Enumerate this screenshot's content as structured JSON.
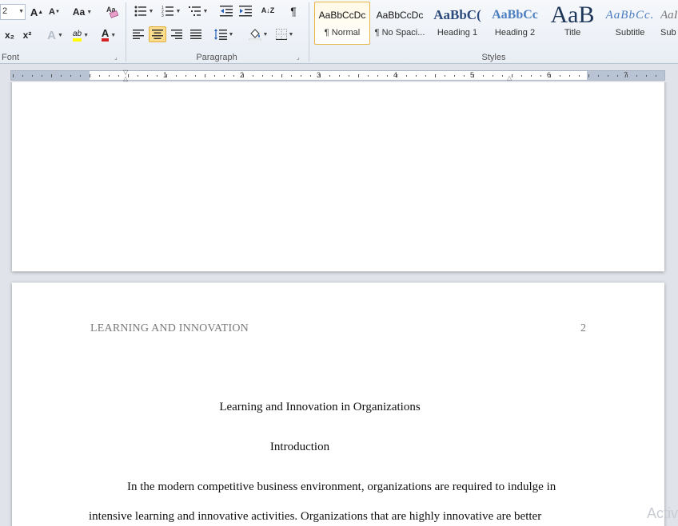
{
  "ribbon": {
    "font_group": {
      "label": "Font",
      "font_size": "2",
      "grow_font": "A",
      "shrink_font": "A",
      "change_case": "Aa",
      "subscript": "x₂",
      "superscript": "x²",
      "text_effects": "A",
      "highlight": "ab",
      "font_color": "A"
    },
    "paragraph_group": {
      "label": "Paragraph",
      "sort": "A↓Z",
      "pilcrow": "¶"
    },
    "styles_group": {
      "label": "Styles",
      "items": [
        {
          "sample": "AaBbCcDc",
          "name": "¶ Normal"
        },
        {
          "sample": "AaBbCcDc",
          "name": "¶ No Spaci..."
        },
        {
          "sample": "AaBbC(",
          "name": "Heading 1"
        },
        {
          "sample": "AaBbCc",
          "name": "Heading 2"
        },
        {
          "sample": "AaB",
          "name": "Title"
        },
        {
          "sample": "AaBbCc.",
          "name": "Subtitle"
        },
        {
          "sample": "AaI",
          "name": "Sub"
        }
      ]
    }
  },
  "ruler": {
    "numbers": [
      "1",
      "2",
      "3",
      "4",
      "5",
      "6",
      "7"
    ]
  },
  "document": {
    "header_title": "LEARNING AND INNOVATION",
    "page_number": "2",
    "title": "Learning and Innovation in Organizations",
    "heading": "Introduction",
    "paragraph_lines": [
      "In the modern competitive business  environment, organizations are required to indulge in",
      "intensive learning and innovative activities. Organizations that are highly innovative are better"
    ]
  },
  "watermark": "Activ",
  "colors": {
    "highlight": "#ffff00",
    "font_color": "#d42020",
    "selected_style_border": "#e5b545"
  }
}
